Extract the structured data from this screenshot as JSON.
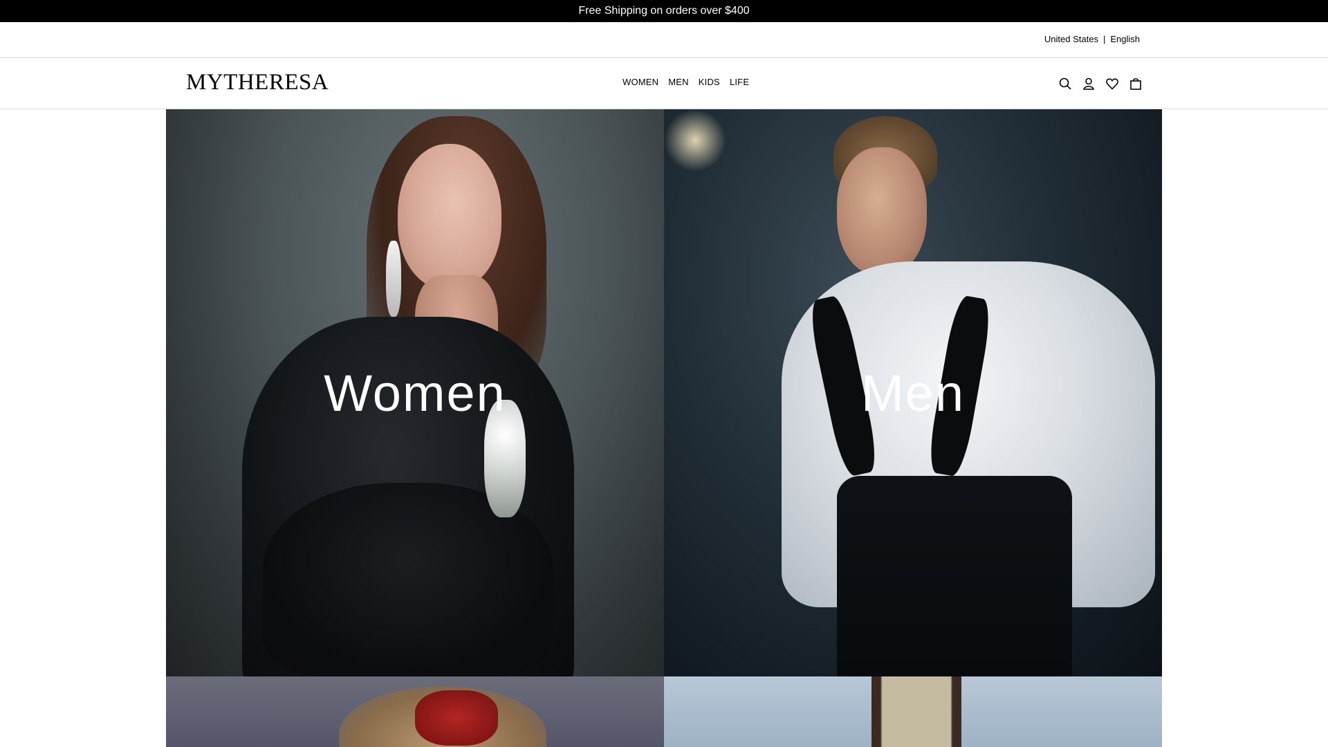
{
  "promo": {
    "text": "Free Shipping on orders over $400"
  },
  "locale": {
    "country": "United States",
    "separator": "|",
    "language": "English"
  },
  "header": {
    "logo": "MYTHERESA",
    "nav": [
      "WOMEN",
      "MEN",
      "KIDS",
      "LIFE"
    ],
    "icons": [
      "search-icon",
      "account-icon",
      "wishlist-icon",
      "bag-icon"
    ]
  },
  "tiles": {
    "women": {
      "label": "Women"
    },
    "men": {
      "label": "Men"
    }
  },
  "colors": {
    "promo_bg": "#000000",
    "border": "#dcdcdc",
    "label_text": "#ffffff"
  }
}
